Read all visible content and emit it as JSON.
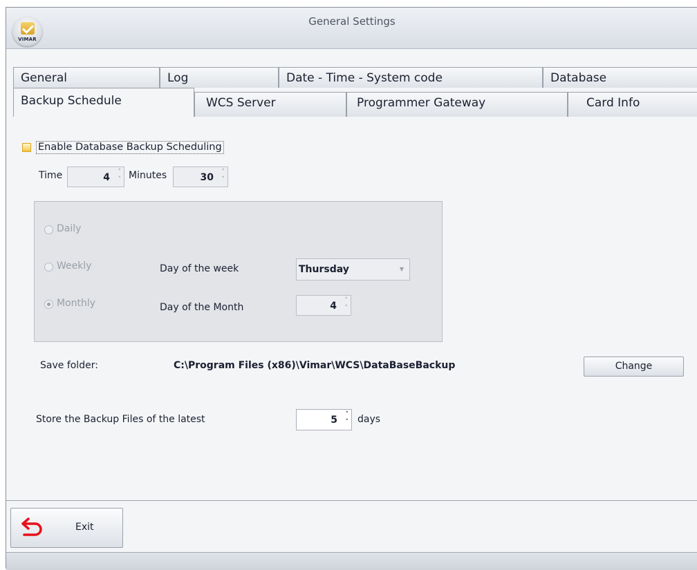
{
  "window": {
    "title": "General Settings",
    "logo_text": "VIMAR"
  },
  "tabs_row1": [
    {
      "label": "General"
    },
    {
      "label": "Log"
    },
    {
      "label": "Date - Time - System code"
    },
    {
      "label": "Database"
    }
  ],
  "tabs_row2": [
    {
      "label": "Backup Schedule",
      "active": true
    },
    {
      "label": "WCS Server"
    },
    {
      "label": "Programmer Gateway"
    },
    {
      "label": "Card Info"
    }
  ],
  "backup": {
    "enable_label": "Enable Database Backup Scheduling",
    "enabled": false,
    "time_label": "Time",
    "time_value": "4",
    "minutes_label": "Minutes",
    "minutes_value": "30",
    "frequency": {
      "daily_label": "Daily",
      "weekly_label": "Weekly",
      "monthly_label": "Monthly",
      "selected": "Monthly",
      "day_of_week_label": "Day of the week",
      "day_of_week_value": "Thursday",
      "day_of_month_label": "Day of the Month",
      "day_of_month_value": "4"
    },
    "save_folder_label": "Save folder:",
    "save_folder_path": "C:\\Program Files (x86)\\Vimar\\WCS\\DataBaseBackup",
    "change_button": "Change",
    "store_label": "Store the Backup Files of the latest",
    "store_value": "5",
    "store_unit": "days"
  },
  "footer": {
    "exit_label": "Exit"
  },
  "colors": {
    "exit_icon": "#e8101a",
    "checkbox": "#f3c64a",
    "window_bg": "#f4f5f7"
  }
}
